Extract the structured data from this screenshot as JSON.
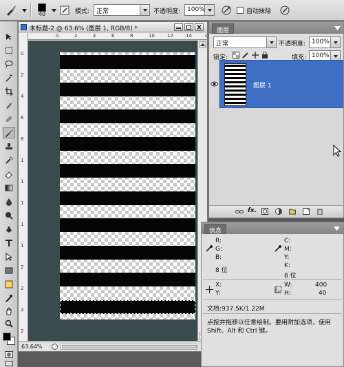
{
  "options_bar": {
    "foreground_chip_value": "40",
    "mode_label": "模式:",
    "mode_value": "正常",
    "opacity_label": "不透明度:",
    "opacity_value": "100%",
    "auto_erase_label": "自动抹除",
    "auto_erase_checked": false
  },
  "document": {
    "title": "未标题-2 @ 63.6% (图层 1, RGB/8) *",
    "zoom": "63.64%",
    "ruler_top_ticks": [
      "0",
      "2",
      "4",
      "6",
      "8",
      "10",
      "12",
      "14",
      "16"
    ],
    "ruler_left_ticks": [
      "0",
      "2",
      "4",
      "6",
      "8",
      "1",
      "1",
      "1",
      "1",
      "1",
      "2",
      "2",
      "2",
      "2"
    ],
    "stripe_count": 10,
    "selected_stripe": 10
  },
  "layers_panel": {
    "tab": "图层",
    "blend_mode": "正常",
    "opacity_label": "不透明度:",
    "opacity_value": "100%",
    "lock_label": "锁定:",
    "fill_label": "填充:",
    "fill_value": "100%",
    "layer_name": "图层 1"
  },
  "info_panel": {
    "tab": "信息",
    "r_label": "R:",
    "g_label": "G:",
    "b_label": "B:",
    "c_label": "C:",
    "m_label": "M:",
    "y_label": "Y:",
    "k_label": "K:",
    "bit_depth_left": "8 位",
    "bit_depth_right": "8 位",
    "x_label": "X:",
    "y_pos_label": "Y:",
    "w_label": "W:",
    "w_value": "400",
    "h_label": "H:",
    "h_value": "40",
    "doc_size": "文档:937.5K/1.22M",
    "hint": "点按并拖移以任意绘制。要用附加选项，使用 Shift、Alt 和 Ctrl 键。"
  },
  "colors": {
    "selection_blue": "#3f6fc4",
    "canvas_bg": "#3b4a4e",
    "stripe": "#050505"
  },
  "icons": [
    "brush-icon",
    "move-icon",
    "marquee-icon",
    "lasso-icon",
    "magic-wand-icon",
    "crop-icon",
    "slice-icon",
    "healing-icon",
    "brush-tool-icon",
    "stamp-icon",
    "history-brush-icon",
    "eraser-icon",
    "gradient-icon",
    "blur-icon",
    "dodge-icon",
    "pen-icon",
    "type-icon",
    "path-select-icon",
    "shape-icon",
    "notes-icon",
    "eyedropper-icon",
    "hand-icon",
    "zoom-icon",
    "color-swatch-icon",
    "quick-mask-icon",
    "screen-mode-icon",
    "eye-icon",
    "airbrush-icon",
    "cursor-icon"
  ]
}
